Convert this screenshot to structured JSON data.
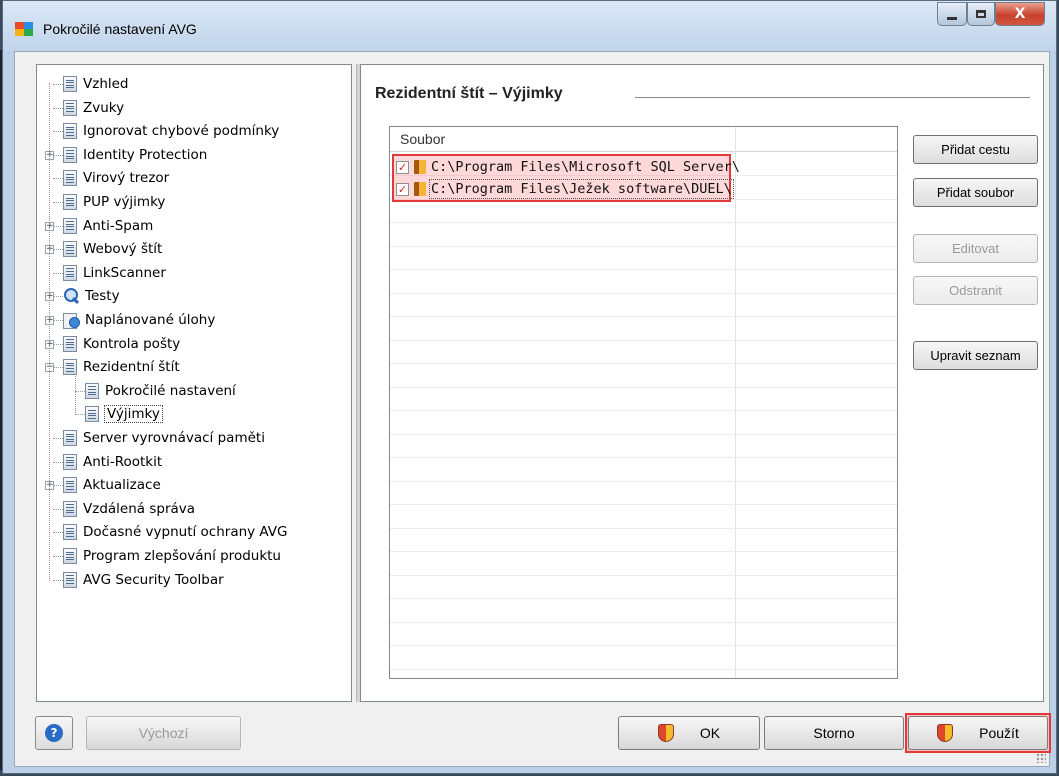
{
  "window": {
    "title": "Pokročilé nastavení AVG",
    "minimize_icon": "minimize-icon",
    "maximize_icon": "maximize-icon",
    "close_glyph": "X"
  },
  "tree": {
    "items": [
      {
        "label": "Vzhled",
        "icon": "document-icon",
        "indent": 0,
        "expander": "none"
      },
      {
        "label": "Zvuky",
        "icon": "document-icon",
        "indent": 0,
        "expander": "none"
      },
      {
        "label": "Ignorovat chybové podmínky",
        "icon": "document-icon",
        "indent": 0,
        "expander": "none"
      },
      {
        "label": "Identity Protection",
        "icon": "document-icon",
        "indent": 0,
        "expander": "plus"
      },
      {
        "label": "Virový trezor",
        "icon": "document-icon",
        "indent": 0,
        "expander": "none"
      },
      {
        "label": "PUP výjimky",
        "icon": "document-icon",
        "indent": 0,
        "expander": "none"
      },
      {
        "label": "Anti-Spam",
        "icon": "document-icon",
        "indent": 0,
        "expander": "plus"
      },
      {
        "label": "Webový štít",
        "icon": "document-icon",
        "indent": 0,
        "expander": "plus"
      },
      {
        "label": "LinkScanner",
        "icon": "document-icon",
        "indent": 0,
        "expander": "none"
      },
      {
        "label": "Testy",
        "icon": "magnifier-icon",
        "indent": 0,
        "expander": "plus"
      },
      {
        "label": "Naplánované úlohy",
        "icon": "clock-icon",
        "indent": 0,
        "expander": "plus"
      },
      {
        "label": "Kontrola pošty",
        "icon": "document-icon",
        "indent": 0,
        "expander": "plus"
      },
      {
        "label": "Rezidentní štít",
        "icon": "document-icon",
        "indent": 0,
        "expander": "minus"
      },
      {
        "label": "Pokročilé nastavení",
        "icon": "document-icon",
        "indent": 1,
        "expander": "none"
      },
      {
        "label": "Výjimky",
        "icon": "document-icon",
        "indent": 1,
        "expander": "none",
        "selected": true
      },
      {
        "label": "Server vyrovnávací paměti",
        "icon": "document-icon",
        "indent": 0,
        "expander": "none"
      },
      {
        "label": "Anti-Rootkit",
        "icon": "document-icon",
        "indent": 0,
        "expander": "none"
      },
      {
        "label": "Aktualizace",
        "icon": "document-icon",
        "indent": 0,
        "expander": "plus"
      },
      {
        "label": "Vzdálená správa",
        "icon": "document-icon",
        "indent": 0,
        "expander": "none"
      },
      {
        "label": "Dočasné vypnutí ochrany AVG",
        "icon": "document-icon",
        "indent": 0,
        "expander": "none"
      },
      {
        "label": "Program zlepšování produktu",
        "icon": "document-icon",
        "indent": 0,
        "expander": "none"
      },
      {
        "label": "AVG Security Toolbar",
        "icon": "document-icon",
        "indent": 0,
        "expander": "none"
      }
    ]
  },
  "main": {
    "section_title": "Rezidentní štít – Výjimky",
    "list": {
      "column_header": "Soubor",
      "entries": [
        {
          "checked": true,
          "icon": "folder-icon",
          "path": "C:\\Program Files\\Microsoft SQL Server\\"
        },
        {
          "checked": true,
          "icon": "folder-icon",
          "path": "C:\\Program Files\\Ježek software\\DUEL\\"
        }
      ]
    },
    "side_buttons": [
      {
        "label": "Přidat cestu",
        "enabled": true
      },
      {
        "label": "Přidat soubor",
        "enabled": true
      },
      {
        "label": "Editovat",
        "enabled": false
      },
      {
        "label": "Odstranit",
        "enabled": false
      },
      {
        "label": "Upravit seznam",
        "enabled": true
      }
    ]
  },
  "footer": {
    "help_icon": "help-icon",
    "help_glyph": "?",
    "default_label": "Výchozí",
    "ok_label": "OK",
    "cancel_label": "Storno",
    "apply_label": "Použít",
    "shield_icon": "avg-shield-icon"
  },
  "colors": {
    "highlight": "#e23a3a",
    "checkmark": "#c62828",
    "selection": "#3399ff"
  }
}
